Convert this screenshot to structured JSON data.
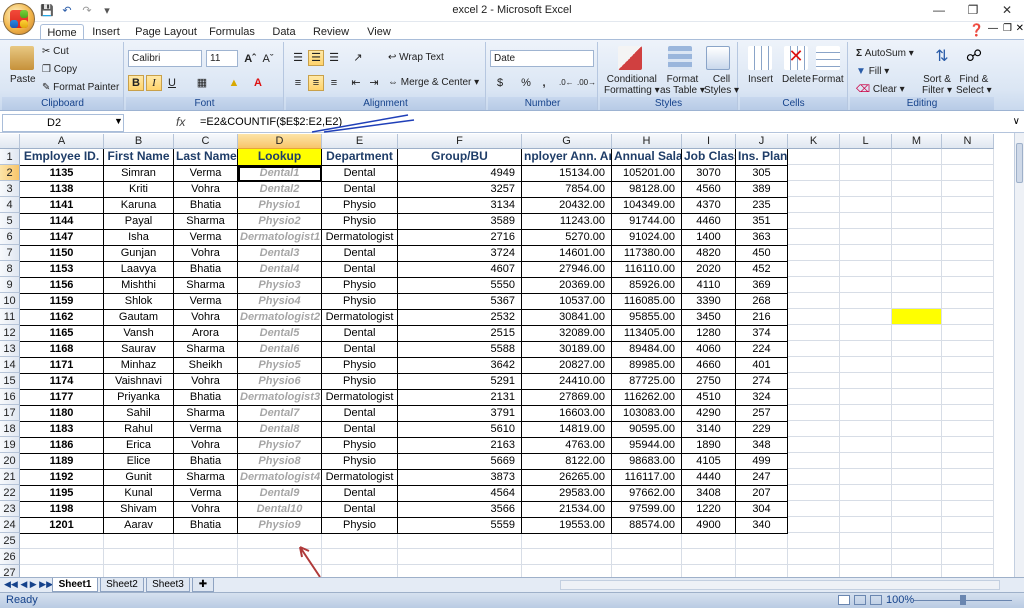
{
  "window": {
    "title": "excel 2 - Microsoft Excel"
  },
  "tabs": [
    "Home",
    "Insert",
    "Page Layout",
    "Formulas",
    "Data",
    "Review",
    "View"
  ],
  "ribbon": {
    "clipboard": {
      "label": "Clipboard",
      "paste": "Paste",
      "cut": "Cut",
      "copy": "Copy",
      "format_painter": "Format Painter"
    },
    "font": {
      "label": "Font",
      "font_name": "Calibri",
      "font_size": "11",
      "bold": "B",
      "italic": "I",
      "underline": "U"
    },
    "alignment": {
      "label": "Alignment",
      "wrap_text": "Wrap Text",
      "merge_center": "Merge & Center"
    },
    "number": {
      "label": "Number",
      "format": "Date",
      "currency": "$",
      "percent": "%",
      "comma": ","
    },
    "styles": {
      "label": "Styles",
      "conditional": "Conditional",
      "conditional2": "Formatting",
      "format_table": "Format",
      "format_table2": "as Table",
      "cell_styles": "Cell",
      "cell_styles2": "Styles"
    },
    "cells": {
      "label": "Cells",
      "insert": "Insert",
      "delete": "Delete",
      "format": "Format"
    },
    "editing": {
      "label": "Editing",
      "autosum": "AutoSum",
      "fill": "Fill",
      "clear": "Clear",
      "sort": "Sort &",
      "sort2": "Filter",
      "find": "Find &",
      "find2": "Select"
    }
  },
  "formula_bar": {
    "name_box": "D2",
    "fx": "fx",
    "formula": "=E2&COUNTIF($E$2:E2,E2)"
  },
  "columns": [
    "A",
    "B",
    "C",
    "D",
    "E",
    "F",
    "G",
    "H",
    "I",
    "J",
    "K",
    "L",
    "M",
    "N"
  ],
  "headers": [
    "Employee ID.",
    "First Name",
    "Last Name",
    "Lookup",
    "Department",
    "Group/BU",
    "nployer Ann. An",
    "Annual Salar",
    "Job Class",
    "Ins. Plan"
  ],
  "rows": [
    [
      "1135",
      "Simran",
      "Verma",
      "Dental1",
      "Dental",
      "4949",
      "15134.00",
      "105201.00",
      "3070",
      "305"
    ],
    [
      "1138",
      "Kriti",
      "Vohra",
      "Dental2",
      "Dental",
      "3257",
      "7854.00",
      "98128.00",
      "4560",
      "389"
    ],
    [
      "1141",
      "Karuna",
      "Bhatia",
      "Physio1",
      "Physio",
      "3134",
      "20432.00",
      "104349.00",
      "4370",
      "235"
    ],
    [
      "1144",
      "Payal",
      "Sharma",
      "Physio2",
      "Physio",
      "3589",
      "11243.00",
      "91744.00",
      "4460",
      "351"
    ],
    [
      "1147",
      "Isha",
      "Verma",
      "Dermatologist1",
      "Dermatologist",
      "2716",
      "5270.00",
      "91024.00",
      "1400",
      "363"
    ],
    [
      "1150",
      "Gunjan",
      "Vohra",
      "Dental3",
      "Dental",
      "3724",
      "14601.00",
      "117380.00",
      "4820",
      "450"
    ],
    [
      "1153",
      "Laavya",
      "Bhatia",
      "Dental4",
      "Dental",
      "4607",
      "27946.00",
      "116110.00",
      "2020",
      "452"
    ],
    [
      "1156",
      "Mishthi",
      "Sharma",
      "Physio3",
      "Physio",
      "5550",
      "20369.00",
      "85926.00",
      "4110",
      "369"
    ],
    [
      "1159",
      "Shlok",
      "Verma",
      "Physio4",
      "Physio",
      "5367",
      "10537.00",
      "116085.00",
      "3390",
      "268"
    ],
    [
      "1162",
      "Gautam",
      "Vohra",
      "Dermatologist2",
      "Dermatologist",
      "2532",
      "30841.00",
      "95855.00",
      "3450",
      "216"
    ],
    [
      "1165",
      "Vansh",
      "Arora",
      "Dental5",
      "Dental",
      "2515",
      "32089.00",
      "113405.00",
      "1280",
      "374"
    ],
    [
      "1168",
      "Saurav",
      "Sharma",
      "Dental6",
      "Dental",
      "5588",
      "30189.00",
      "89484.00",
      "4060",
      "224"
    ],
    [
      "1171",
      "Minhaz",
      "Sheikh",
      "Physio5",
      "Physio",
      "3642",
      "20827.00",
      "89985.00",
      "4660",
      "401"
    ],
    [
      "1174",
      "Vaishnavi",
      "Vohra",
      "Physio6",
      "Physio",
      "5291",
      "24410.00",
      "87725.00",
      "2750",
      "274"
    ],
    [
      "1177",
      "Priyanka",
      "Bhatia",
      "Dermatologist3",
      "Dermatologist",
      "2131",
      "27869.00",
      "116262.00",
      "4510",
      "324"
    ],
    [
      "1180",
      "Sahil",
      "Sharma",
      "Dental7",
      "Dental",
      "3791",
      "16603.00",
      "103083.00",
      "4290",
      "257"
    ],
    [
      "1183",
      "Rahul",
      "Verma",
      "Dental8",
      "Dental",
      "5610",
      "14819.00",
      "90595.00",
      "3140",
      "229"
    ],
    [
      "1186",
      "Erica",
      "Vohra",
      "Physio7",
      "Physio",
      "2163",
      "4763.00",
      "95944.00",
      "1890",
      "348"
    ],
    [
      "1189",
      "Elice",
      "Bhatia",
      "Physio8",
      "Physio",
      "5669",
      "8122.00",
      "98683.00",
      "4105",
      "499"
    ],
    [
      "1192",
      "Gunit",
      "Sharma",
      "Dermatologist4",
      "Dermatologist",
      "3873",
      "26265.00",
      "116117.00",
      "4440",
      "247"
    ],
    [
      "1195",
      "Kunal",
      "Verma",
      "Dental9",
      "Dental",
      "4564",
      "29583.00",
      "97662.00",
      "3408",
      "207"
    ],
    [
      "1198",
      "Shivam",
      "Vohra",
      "Dental10",
      "Dental",
      "3566",
      "21534.00",
      "97599.00",
      "1220",
      "304"
    ],
    [
      "1201",
      "Aarav",
      "Bhatia",
      "Physio9",
      "Physio",
      "5559",
      "19553.00",
      "88574.00",
      "4900",
      "340"
    ]
  ],
  "row_numbers": [
    "1",
    "2",
    "3",
    "4",
    "5",
    "6",
    "7",
    "8",
    "9",
    "10",
    "11",
    "12",
    "13",
    "14",
    "15",
    "16",
    "17",
    "18",
    "19",
    "20",
    "21",
    "22",
    "23",
    "24",
    "25",
    "26",
    "27"
  ],
  "sheets": [
    "Sheet1",
    "Sheet2",
    "Sheet3"
  ],
  "status": {
    "ready": "Ready",
    "zoom": "100%"
  },
  "colors": {
    "lookup_header": "#ffff00",
    "highlight_m11": "#ffff00",
    "annotation": "#1f3fb8",
    "arrow": "#b03a3a"
  }
}
